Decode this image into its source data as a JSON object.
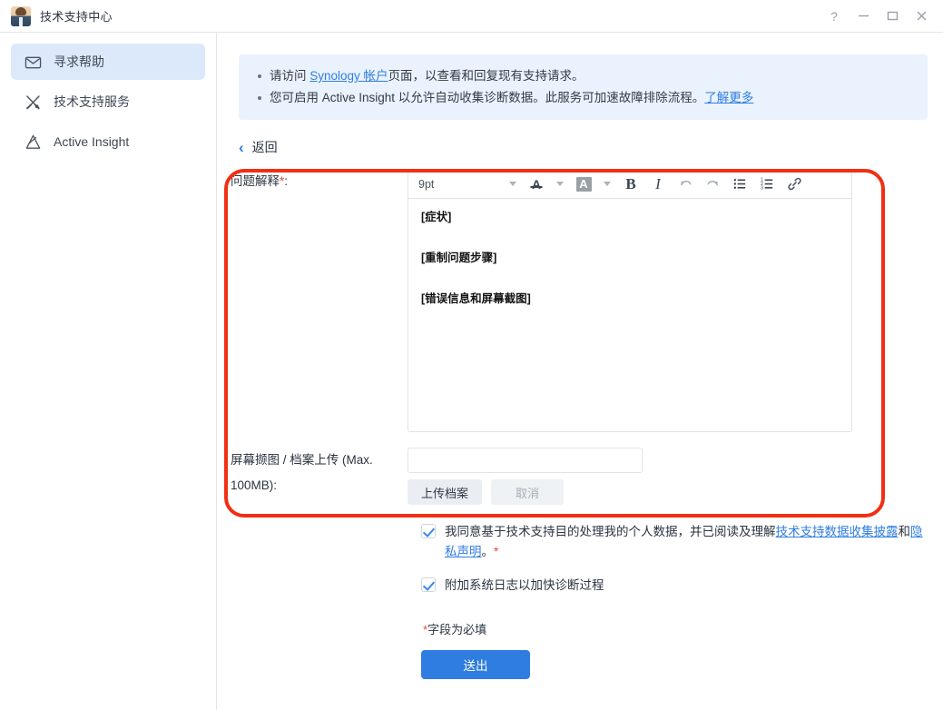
{
  "window": {
    "title": "技术支持中心",
    "avatar_icon": "support-agent-avatar",
    "controls": {
      "help": "?",
      "minimize": "minimize-icon",
      "maximize": "maximize-icon",
      "close": "close-icon"
    }
  },
  "sidebar": {
    "items": [
      {
        "label": "寻求帮助",
        "icon": "envelope-icon",
        "active": true
      },
      {
        "label": "技术支持服务",
        "icon": "tools-icon",
        "active": false
      },
      {
        "label": "Active Insight",
        "icon": "active-insight-icon",
        "active": false
      }
    ]
  },
  "notice": {
    "line1_pre": "请访问 ",
    "line1_link": "Synology 帐户",
    "line1_post": "页面，以查看和回复现有支持请求。",
    "line2_pre": "您可启用 Active Insight 以允许自动收集诊断数据。此服务可加速故障排除流程。",
    "line2_link": "了解更多"
  },
  "back": {
    "label": "返回",
    "icon": "chevron-left-icon"
  },
  "form": {
    "description_label": "问题解释",
    "description_required": "*",
    "description_colon": ":",
    "editor": {
      "font_size": "9pt",
      "toolbar": [
        {
          "name": "font-size-select",
          "label": "9pt"
        },
        {
          "name": "font-size-caret",
          "label": "▾"
        },
        {
          "name": "font-color-button",
          "label": "A"
        },
        {
          "name": "font-color-caret",
          "label": "▾"
        },
        {
          "name": "highlight-color-button",
          "label": "A"
        },
        {
          "name": "highlight-color-caret",
          "label": "▾"
        },
        {
          "name": "bold-button",
          "label": "B"
        },
        {
          "name": "italic-button",
          "label": "I"
        },
        {
          "name": "undo-button",
          "label": "↶"
        },
        {
          "name": "redo-button",
          "label": "↷"
        },
        {
          "name": "bullet-list-button",
          "label": "•≡"
        },
        {
          "name": "numbered-list-button",
          "label": "1≡"
        },
        {
          "name": "insert-link-button",
          "label": "🔗"
        }
      ],
      "content": [
        "[症状]",
        "[重制问题步骤]",
        "[错误信息和屏幕截图]"
      ]
    },
    "upload_label_line1": "屏幕撷图 / 档案上传 (Max.",
    "upload_label_line2": "100MB):",
    "upload_value": "",
    "upload_placeholder": "",
    "upload_button": "上传档案",
    "cancel_button": "取消"
  },
  "agreements": [
    {
      "checked": true,
      "pre": "我同意基于技术支持目的处理我的个人数据，并已阅读及理解",
      "link1": "技术支持数据收集披露",
      "mid": "和",
      "link2": "隐私声明",
      "post": "。",
      "required": "*"
    },
    {
      "checked": true,
      "pre": "附加系统日志以加快诊断过程",
      "link1": "",
      "mid": "",
      "link2": "",
      "post": "",
      "required": ""
    }
  ],
  "footer": {
    "required_star": "*",
    "required_note": "字段为必填",
    "submit_label": "送出"
  },
  "colors": {
    "accent": "#2f7de1",
    "highlight_box": "#f02f14",
    "notice_bg": "#eaf2fd",
    "sidebar_active": "#dce9fa",
    "required_red": "#e8453c"
  }
}
